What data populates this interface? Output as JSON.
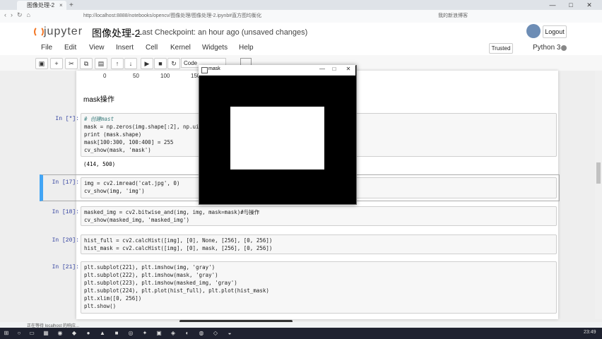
{
  "browser": {
    "tab_title": "图像处理-2",
    "url": "http://localhost:8888/notebooks/opencv/图像处理/图像处理-2.ipynb#直方图均衡化",
    "address_right": "我的新浪博客"
  },
  "jupyter": {
    "logo": "jupyter",
    "notebook_title": "图像处理-2",
    "checkpoint": "Last Checkpoint: an hour ago (unsaved changes)",
    "logout": "Logout",
    "trusted": "Trusted",
    "kernel": "Python 3",
    "menu": [
      "File",
      "Edit",
      "View",
      "Insert",
      "Cell",
      "Kernel",
      "Widgets",
      "Help"
    ],
    "cell_type": "Code"
  },
  "toolbar_icons": [
    "save-icon",
    "plus-icon",
    "cut-icon",
    "copy-icon",
    "paste-icon",
    "arrow-up-icon",
    "arrow-down-icon",
    "run-icon",
    "stop-icon",
    "restart-icon"
  ],
  "axis_ticks": [
    "0",
    "50",
    "100",
    "150"
  ],
  "markdown": "mask操作",
  "cells": [
    {
      "prompt": "In [*]:",
      "lines": [
        "# 创建mast",
        "mask = np.zeros(img.shape[:2], np.uint8)",
        "print (mask.shape)",
        "mask[100:300, 100:400] = 255",
        "cv_show(mask, 'mask')"
      ],
      "output": "(414, 500)"
    },
    {
      "prompt": "In [17]:",
      "lines": [
        "img = cv2.imread('cat.jpg', 0)",
        "cv_show(img, 'img')"
      ]
    },
    {
      "prompt": "In [18]:",
      "lines": [
        "masked_img = cv2.bitwise_and(img, img, mask=mask)#与操作",
        "cv_show(masked_img, 'masked_img')"
      ]
    },
    {
      "prompt": "In [20]:",
      "lines": [
        "hist_full = cv2.calcHist([img], [0], None, [256], [0, 256])",
        "hist_mask = cv2.calcHist([img], [0], mask, [256], [0, 256])"
      ]
    },
    {
      "prompt": "In [21]:",
      "lines": [
        "plt.subplot(221), plt.imshow(img, 'gray')",
        "plt.subplot(222), plt.imshow(mask, 'gray')",
        "plt.subplot(223), plt.imshow(masked_img, 'gray')",
        "plt.subplot(224), plt.plot(hist_full), plt.plot(hist_mask)",
        "plt.xlim([0, 256])",
        "plt.show()"
      ]
    }
  ],
  "mask_window": {
    "title": "mask",
    "minimize": "—",
    "maximize": "□",
    "close": "✕"
  },
  "status_text": "正在等待 localhost 的响应...",
  "clock": "23:49"
}
